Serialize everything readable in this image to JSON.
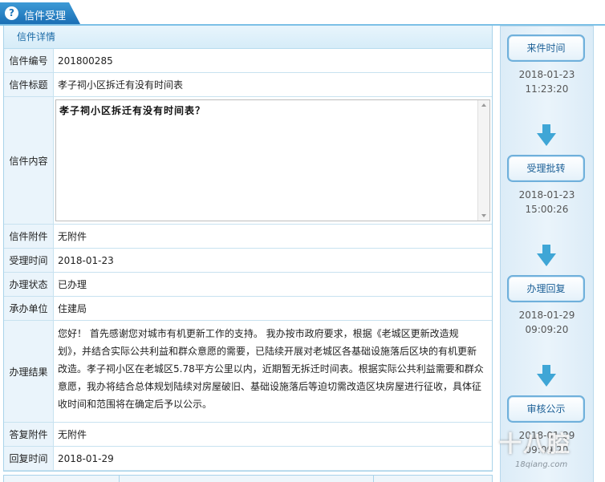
{
  "header": {
    "tab_label": "信件受理",
    "tab_icon": "question-icon"
  },
  "detail": {
    "section_title": "信件详情",
    "rows": [
      {
        "label": "信件编号",
        "value": "201800285"
      },
      {
        "label": "信件标题",
        "value": "孝子祠小区拆迁有没有时间表"
      },
      {
        "label": "信件内容",
        "value": "孝子祠小区拆迁有没有时间表？"
      },
      {
        "label": "信件附件",
        "value": "无附件"
      },
      {
        "label": "受理时间",
        "value": "2018-01-23"
      },
      {
        "label": "办理状态",
        "value": "已办理"
      },
      {
        "label": "承办单位",
        "value": "住建局"
      },
      {
        "label": "办理结果",
        "lines": [
          "您好！ 首先感谢您对城市有机更新工作的支持。 我办按市政府要求，根据《老城区更新改造规",
          "划》，并结合实际公共利益和群众意愿的需要，已陆续开展对老城区各基础设施落后区块的有机更新",
          "改造。孝子祠小区在老城区5.78平方公里以内，近期暂无拆迁时间表。根据实际公共利益需要和群众",
          "意愿，我办将结合总体规划陆续对房屋破旧、基础设施落后等迫切需改造区块房屋进行征收，具体征",
          "收时间和范围将在确定后予以公示。"
        ]
      },
      {
        "label": "答复附件",
        "value": "无附件"
      },
      {
        "label": "回复时间",
        "value": "2018-01-29"
      }
    ]
  },
  "progress": {
    "steps": [
      {
        "label": "来件时间",
        "date": "2018-01-23",
        "time": "11:23:20"
      },
      {
        "label": "受理批转",
        "date": "2018-01-23",
        "time": "15:00:26"
      },
      {
        "label": "办理回复",
        "date": "2018-01-29",
        "time": "09:09:20"
      },
      {
        "label": "审核公示",
        "date": "2018-01-29",
        "time": "09:09:20"
      }
    ],
    "arrow_color": "#3fa6d6",
    "button_border_color": "#6fb0db"
  },
  "watermark": {
    "text": "十八腔",
    "url": "18qiang.com"
  },
  "colors": {
    "tab_blue": "#1c74b8",
    "header_text": "#1a6aa6",
    "label_bg": "#eaf4fb"
  }
}
